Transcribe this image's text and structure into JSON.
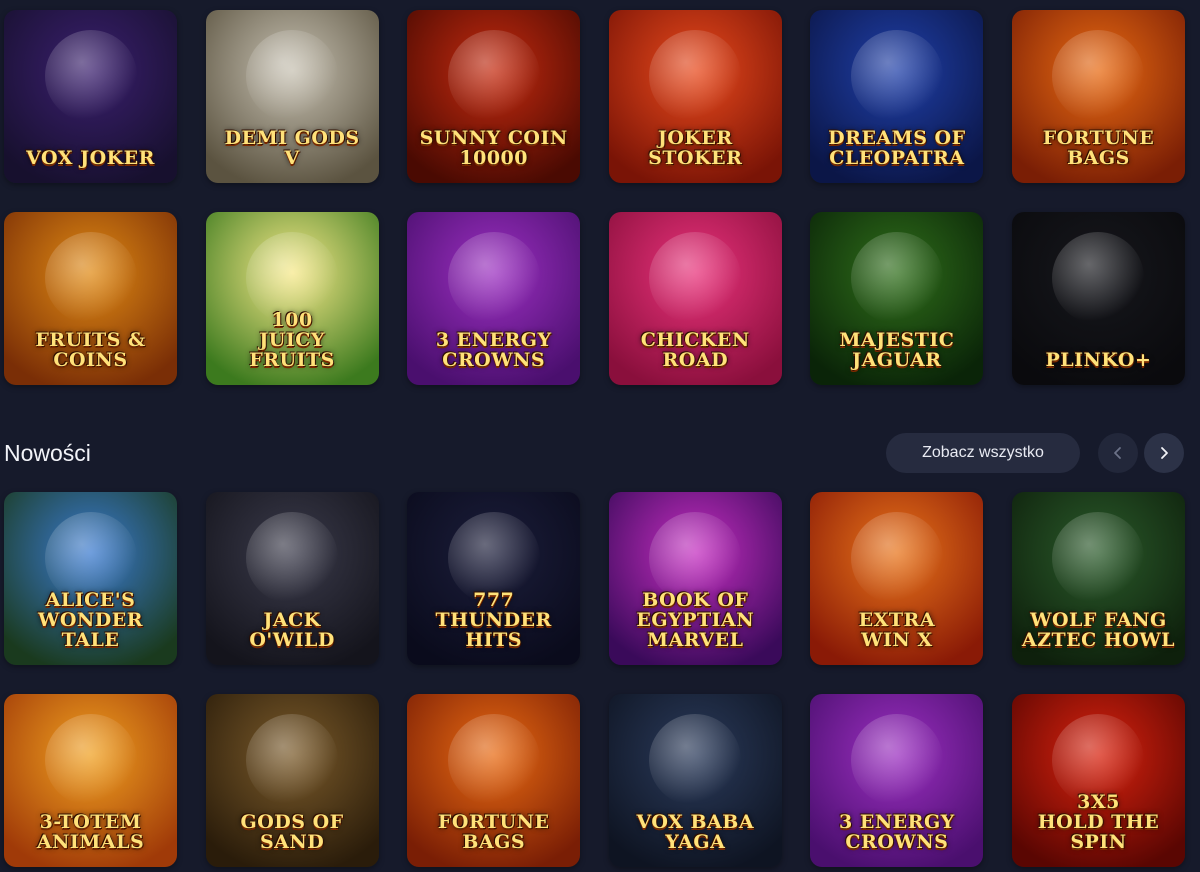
{
  "section": {
    "title": "Nowości",
    "see_all_label": "Zobacz wszystko",
    "prev_icon": "chevron-left-icon",
    "next_icon": "chevron-right-icon"
  },
  "top_games": [
    {
      "title": "VOX JOKER",
      "colors": [
        "#3a1f6e",
        "#17102e"
      ]
    },
    {
      "title": "DEMI GODS V",
      "colors": [
        "#c7c1b2",
        "#5b5340"
      ]
    },
    {
      "title": "SUNNY COIN\n10000",
      "colors": [
        "#c42a0f",
        "#4a0a02"
      ]
    },
    {
      "title": "JOKER STOKER",
      "colors": [
        "#e8491c",
        "#7a1406"
      ]
    },
    {
      "title": "DREAMS OF\nCLEOPATRA",
      "colors": [
        "#1f3fa8",
        "#0b1647"
      ]
    },
    {
      "title": "FORTUNE\nBAGS",
      "colors": [
        "#e86a12",
        "#7a1e05"
      ]
    },
    {
      "title": "FRUITS & COINS",
      "colors": [
        "#e08a14",
        "#7a2e06"
      ]
    },
    {
      "title": "100\nJUICY FRUITS",
      "colors": [
        "#f7e98a",
        "#3c7a1e"
      ]
    },
    {
      "title": "3 ENERGY\nCROWNS",
      "colors": [
        "#9b2fc0",
        "#4a0f6e"
      ]
    },
    {
      "title": "CHICKEN\nROAD",
      "colors": [
        "#e8327a",
        "#8a0f3c"
      ]
    },
    {
      "title": "MAJESTIC\nJAGUAR",
      "colors": [
        "#2f6e1a",
        "#0a2408"
      ]
    },
    {
      "title": "PLINKO+",
      "colors": [
        "#16171c",
        "#0a0a0d"
      ]
    }
  ],
  "new_games": [
    {
      "title": "ALICE'S\nWONDER TALE",
      "colors": [
        "#3a7ad0",
        "#1a3a1e"
      ]
    },
    {
      "title": "JACK\nO'WILD",
      "colors": [
        "#3a3a4a",
        "#14141c"
      ]
    },
    {
      "title": "777\nTHUNDER HITS",
      "colors": [
        "#1b1d3a",
        "#0a0b1c"
      ]
    },
    {
      "title": "BOOK OF\nEGYPTIAN MARVEL",
      "colors": [
        "#c42ec0",
        "#3a0a5a"
      ]
    },
    {
      "title": "EXTRA\nWIN X",
      "colors": [
        "#e8741a",
        "#8a1a06"
      ]
    },
    {
      "title": "WOLF FANG\nAZTEC HOWL",
      "colors": [
        "#2a5a2a",
        "#0e200c"
      ]
    },
    {
      "title": "3-TOTEM\nANIMALS",
      "colors": [
        "#f0a020",
        "#a03a08"
      ]
    },
    {
      "title": "GODS OF SAND",
      "colors": [
        "#7a5a2a",
        "#2a1c0a"
      ]
    },
    {
      "title": "FORTUNE\nBAGS",
      "colors": [
        "#e86a12",
        "#7a1e05"
      ]
    },
    {
      "title": "VOX BABA YAGA",
      "colors": [
        "#2a3a5a",
        "#0e1422"
      ]
    },
    {
      "title": "3 ENERGY\nCROWNS",
      "colors": [
        "#9b2fc0",
        "#4a0f6e"
      ]
    },
    {
      "title": "3X5\nHOLD THE SPIN",
      "colors": [
        "#d8220e",
        "#5a0602"
      ]
    }
  ]
}
